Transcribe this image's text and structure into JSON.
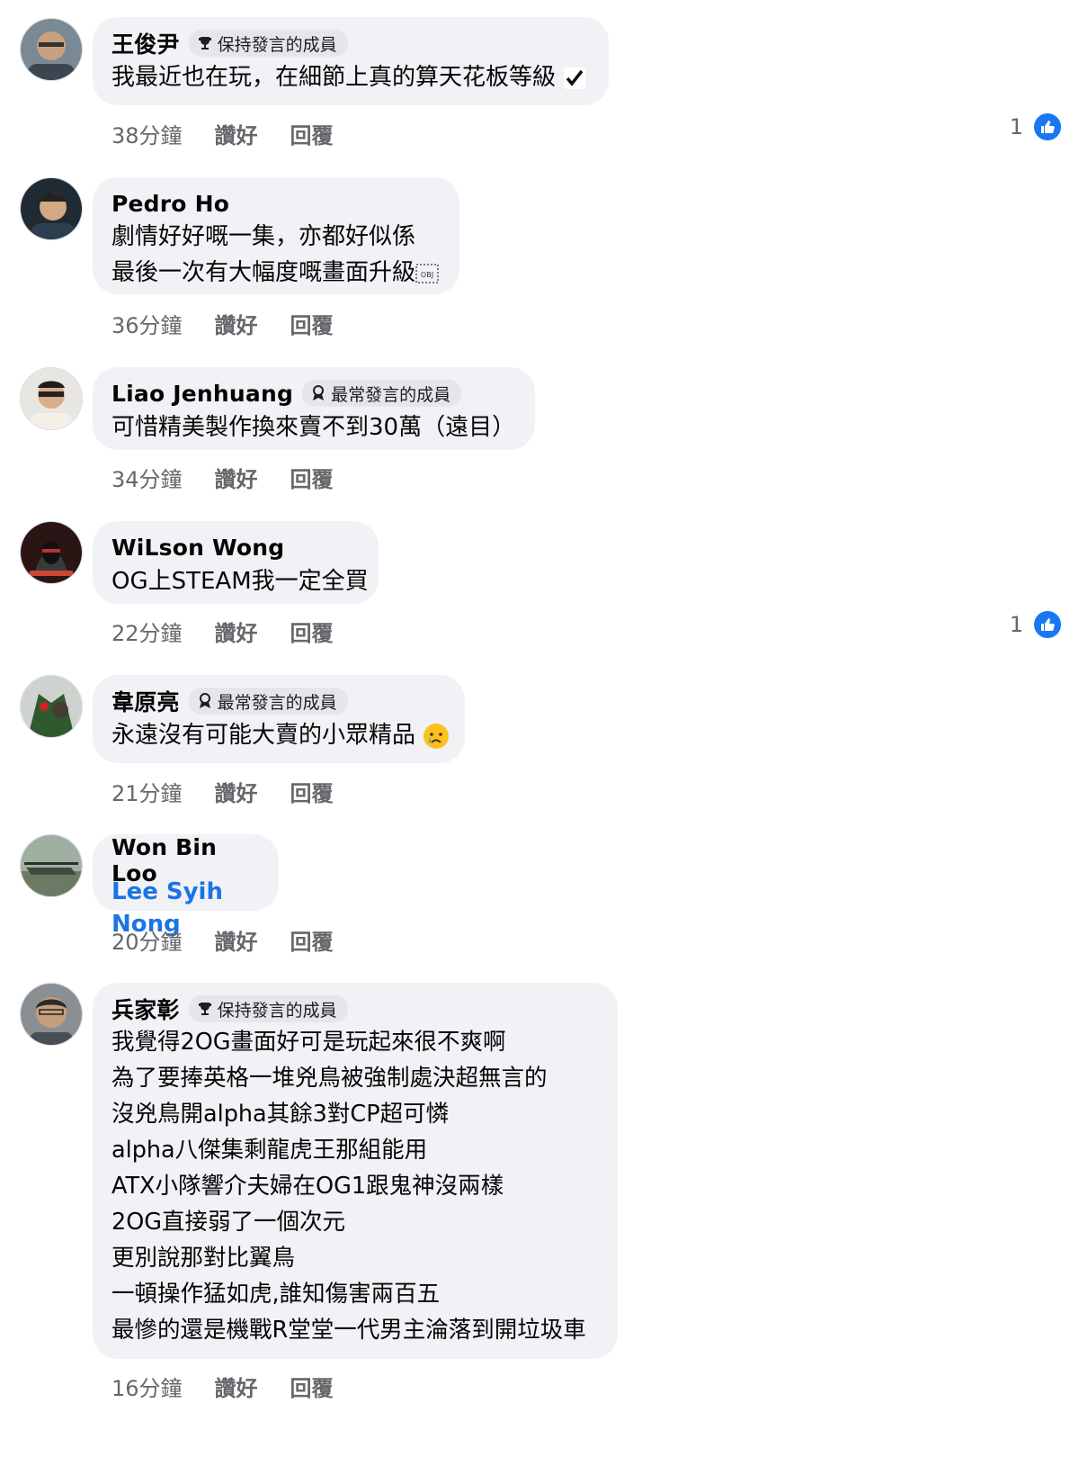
{
  "comments": [
    {
      "name": "王俊尹",
      "badge": "保持發言的成員",
      "badge_icon": "trophy-icon",
      "lines": [
        "我最近也在玩，在細節上真的算天花板等級"
      ],
      "trailing_icon": "checkmark-icon",
      "time": "38分鐘",
      "like_label": "讚好",
      "reply_label": "回覆",
      "reaction_count": "1"
    },
    {
      "name": "Pedro Ho",
      "lines": [
        "劇情好好嘅一集，亦都好似係",
        "最後一次有大幅度嘅畫面升級"
      ],
      "trailing_icon": "object-placeholder-icon",
      "time": "36分鐘",
      "like_label": "讚好",
      "reply_label": "回覆"
    },
    {
      "name": "Liao Jenhuang",
      "badge": "最常發言的成員",
      "badge_icon": "ribbon-icon",
      "lines": [
        "可惜精美製作換來賣不到30萬（遠目）"
      ],
      "time": "34分鐘",
      "like_label": "讚好",
      "reply_label": "回覆"
    },
    {
      "name": "WiLson Wong",
      "lines": [
        "OG上STEAM我一定全買"
      ],
      "time": "22分鐘",
      "like_label": "讚好",
      "reply_label": "回覆",
      "reaction_count": "1"
    },
    {
      "name": "韋原亮",
      "badge": "最常發言的成員",
      "badge_icon": "ribbon-icon",
      "lines": [
        "永遠沒有可能大賣的小眾精品"
      ],
      "trailing_icon": "crying-face-emoji",
      "time": "21分鐘",
      "like_label": "讚好",
      "reply_label": "回覆"
    },
    {
      "name": "Won Bin Loo",
      "mention": "Lee Syih Nong",
      "time": "20分鐘",
      "like_label": "讚好",
      "reply_label": "回覆"
    },
    {
      "name": "兵家彰",
      "badge": "保持發言的成員",
      "badge_icon": "trophy-icon",
      "lines": [
        "我覺得2OG畫面好可是玩起來很不爽啊",
        "為了要捧英格一堆兇鳥被強制處決超無言的",
        "沒兇鳥開alpha其餘3對CP超可憐",
        "alpha八傑集剩龍虎王那組能用",
        "ATX小隊響介夫婦在OG1跟鬼神沒兩樣",
        "2OG直接弱了一個次元",
        "更別說那對比翼鳥",
        "一頓操作猛如虎,誰知傷害兩百五",
        "最慘的還是機戰R堂堂一代男主淪落到開垃圾車"
      ],
      "time": "16分鐘",
      "like_label": "讚好",
      "reply_label": "回覆"
    }
  ],
  "colors": {
    "bubble": "#f0f2f5",
    "meta_text": "#65676b",
    "like_blue": "#1877f2",
    "mention_blue": "#1b74e4"
  }
}
